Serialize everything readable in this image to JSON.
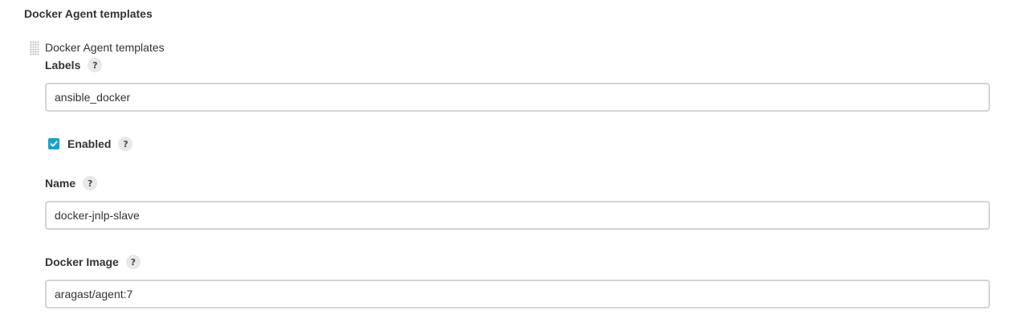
{
  "section": {
    "title": "Docker Agent templates"
  },
  "template": {
    "header": "Docker Agent templates",
    "help_glyph": "?",
    "labels": {
      "label": "Labels",
      "value": "ansible_docker"
    },
    "enabled": {
      "label": "Enabled",
      "checked": true
    },
    "name": {
      "label": "Name",
      "value": "docker-jnlp-slave"
    },
    "docker_image": {
      "label": "Docker Image",
      "value": "aragast/agent:7"
    }
  },
  "colors": {
    "checkbox": "#1ba1c9",
    "input_border": "#cfd6d6",
    "help_bg": "#e8e8e8"
  }
}
